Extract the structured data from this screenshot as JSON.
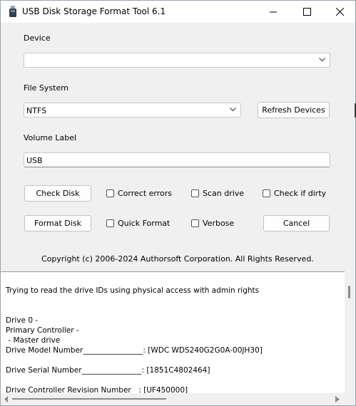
{
  "window": {
    "title": "USB Disk Storage Format Tool 6.1",
    "controls": {
      "minimize": "minimize-icon",
      "maximize": "maximize-icon",
      "close": "close-icon"
    }
  },
  "form": {
    "device_label": "Device",
    "device_value": "",
    "file_system_label": "File System",
    "file_system_value": "NTFS",
    "refresh_button": "Refresh Devices",
    "volume_label_label": "Volume Label",
    "volume_label_value": "USB",
    "check_disk_button": "Check Disk",
    "correct_errors": "Correct errors",
    "scan_drive": "Scan drive",
    "check_if_dirty": "Check if dirty",
    "format_disk_button": "Format Disk",
    "quick_format": "Quick Format",
    "verbose": "Verbose",
    "cancel_button": "Cancel",
    "copyright": "Copyright (c) 2006-2024 Authorsoft Corporation. All Rights Reserved."
  },
  "log": [
    "Trying to read the drive IDs using physical access with admin rights",
    "Drive 0 -",
    "Primary Controller -",
    " - Master drive",
    "Drive Model Number________________: [WDC WDS240G2G0A-00JH30]",
    "Drive Serial Number________________: [1851C4802464]",
    "Drive Controller Revision Number__: [UF450000]"
  ]
}
